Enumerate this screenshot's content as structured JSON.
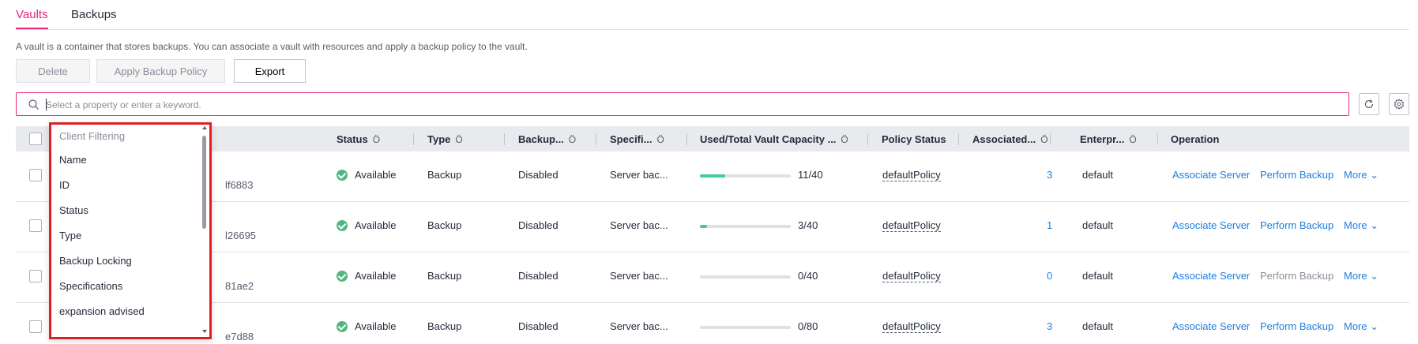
{
  "tabs": [
    {
      "label": "Vaults",
      "active": true
    },
    {
      "label": "Backups",
      "active": false
    }
  ],
  "description": "A vault is a container that stores backups. You can associate a vault with resources and apply a backup policy to the vault.",
  "toolbar": {
    "delete_label": "Delete",
    "apply_policy_label": "Apply Backup Policy",
    "export_label": "Export"
  },
  "search": {
    "placeholder": "Select a property or enter a keyword."
  },
  "columns": {
    "status": "Status",
    "type": "Type",
    "backup_locking": "Backup...",
    "specifications": "Specifi...",
    "capacity": "Used/Total Vault Capacity ...",
    "policy_status": "Policy Status",
    "associated": "Associated...",
    "enterprise": "Enterpr...",
    "operation": "Operation",
    "sort_icon": "Ö"
  },
  "rows": [
    {
      "id_fragment": "lf6883",
      "status": "Available",
      "type": "Backup",
      "backup_locking": "Disabled",
      "specifications": "Server bac...",
      "capacity": "11/40",
      "usage_fraction": 0.275,
      "policy": "defaultPolicy",
      "associated": "3",
      "enterprise": "default",
      "op_associate": "Associate Server",
      "op_backup": "Perform Backup",
      "op_backup_enabled": true,
      "op_more": "More"
    },
    {
      "id_fragment": "l26695",
      "status": "Available",
      "type": "Backup",
      "backup_locking": "Disabled",
      "specifications": "Server bac...",
      "capacity": "3/40",
      "usage_fraction": 0.075,
      "policy": "defaultPolicy",
      "associated": "1",
      "enterprise": "default",
      "op_associate": "Associate Server",
      "op_backup": "Perform Backup",
      "op_backup_enabled": true,
      "op_more": "More"
    },
    {
      "id_fragment": "81ae2",
      "status": "Available",
      "type": "Backup",
      "backup_locking": "Disabled",
      "specifications": "Server bac...",
      "capacity": "0/40",
      "usage_fraction": 0,
      "policy": "defaultPolicy",
      "associated": "0",
      "enterprise": "default",
      "op_associate": "Associate Server",
      "op_backup": "Perform Backup",
      "op_backup_enabled": false,
      "op_more": "More"
    },
    {
      "id_fragment": "e7d88",
      "status": "Available",
      "type": "Backup",
      "backup_locking": "Disabled",
      "specifications": "Server bac...",
      "capacity": "0/80",
      "usage_fraction": 0,
      "policy": "defaultPolicy",
      "associated": "3",
      "enterprise": "default",
      "op_associate": "Associate Server",
      "op_backup": "Perform Backup",
      "op_backup_enabled": true,
      "op_more": "More"
    }
  ],
  "dropdown": {
    "header": "Client Filtering",
    "items": [
      "Name",
      "ID",
      "Status",
      "Type",
      "Backup Locking",
      "Specifications",
      "expansion advised"
    ]
  },
  "colors": {
    "accent": "#e5257a",
    "link": "#1e7fe0",
    "status_ok": "#50b87f",
    "bar_fill": "#3dcca6",
    "highlight_box": "#e02020"
  }
}
